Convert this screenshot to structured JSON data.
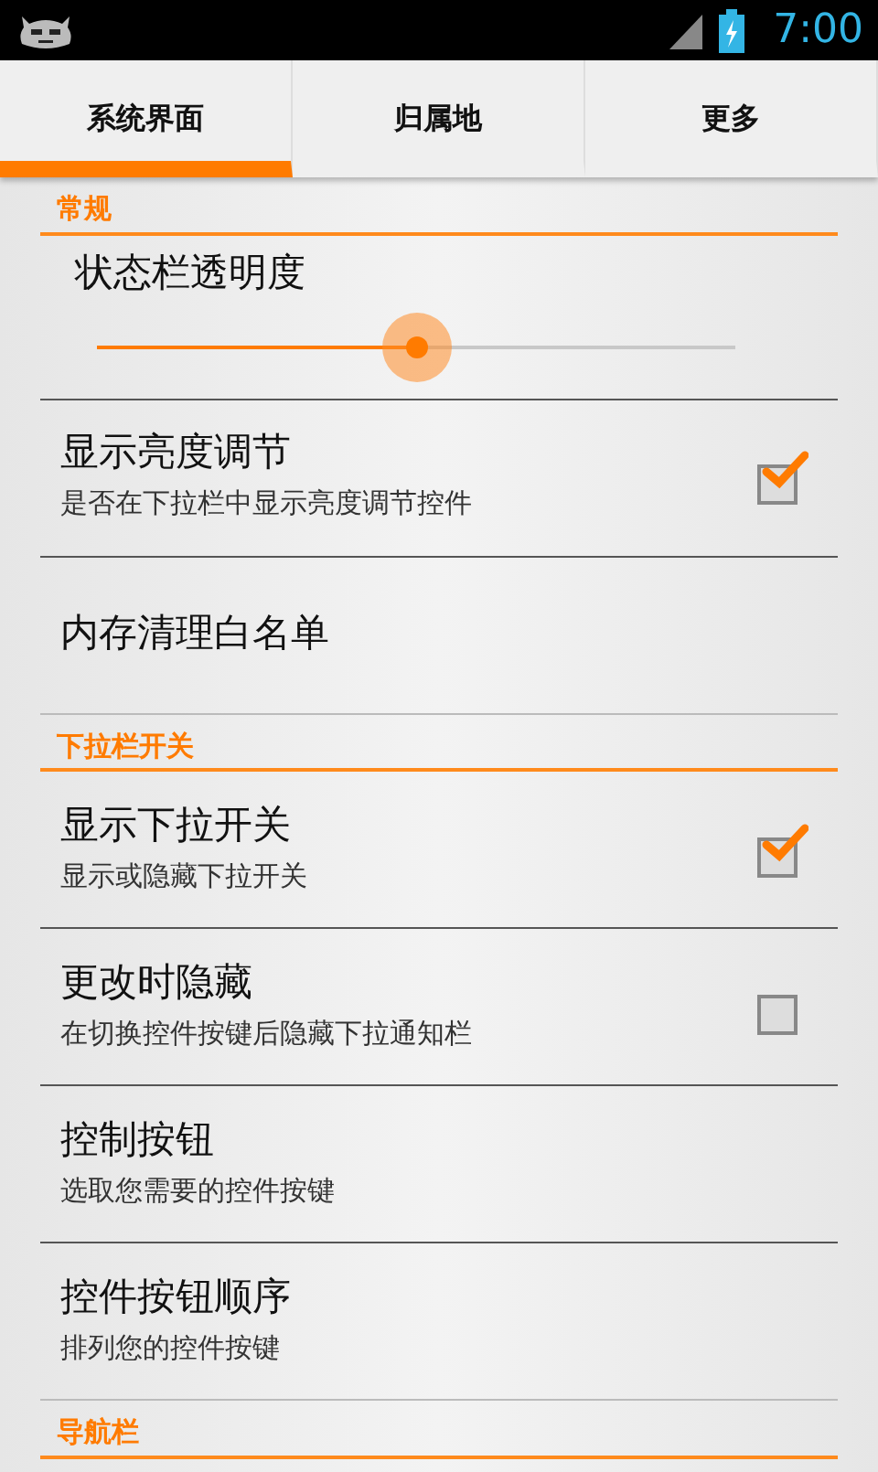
{
  "status_bar": {
    "time": "7:00"
  },
  "tabs": [
    {
      "label": "系统界面",
      "selected": true
    },
    {
      "label": "归属地",
      "selected": false
    },
    {
      "label": "更多",
      "selected": false
    }
  ],
  "sections": [
    {
      "title": "常规",
      "items": [
        {
          "kind": "slider",
          "title": "状态栏透明度",
          "level": 0.5
        },
        {
          "kind": "checkbox",
          "title": "显示亮度调节",
          "summary": "是否在下拉栏中显示亮度调节控件",
          "checked": true
        },
        {
          "kind": "plain",
          "title": "内存清理白名单"
        }
      ]
    },
    {
      "title": "下拉栏开关",
      "items": [
        {
          "kind": "checkbox",
          "title": "显示下拉开关",
          "summary": "显示或隐藏下拉开关",
          "checked": true
        },
        {
          "kind": "checkbox",
          "title": "更改时隐藏",
          "summary": "在切换控件按键后隐藏下拉通知栏",
          "checked": false
        },
        {
          "kind": "plain",
          "title": "控制按钮",
          "summary": "选取您需要的控件按键"
        },
        {
          "kind": "plain",
          "title": "控件按钮顺序",
          "summary": "排列您的控件按键"
        }
      ]
    },
    {
      "title": "导航栏"
    }
  ]
}
